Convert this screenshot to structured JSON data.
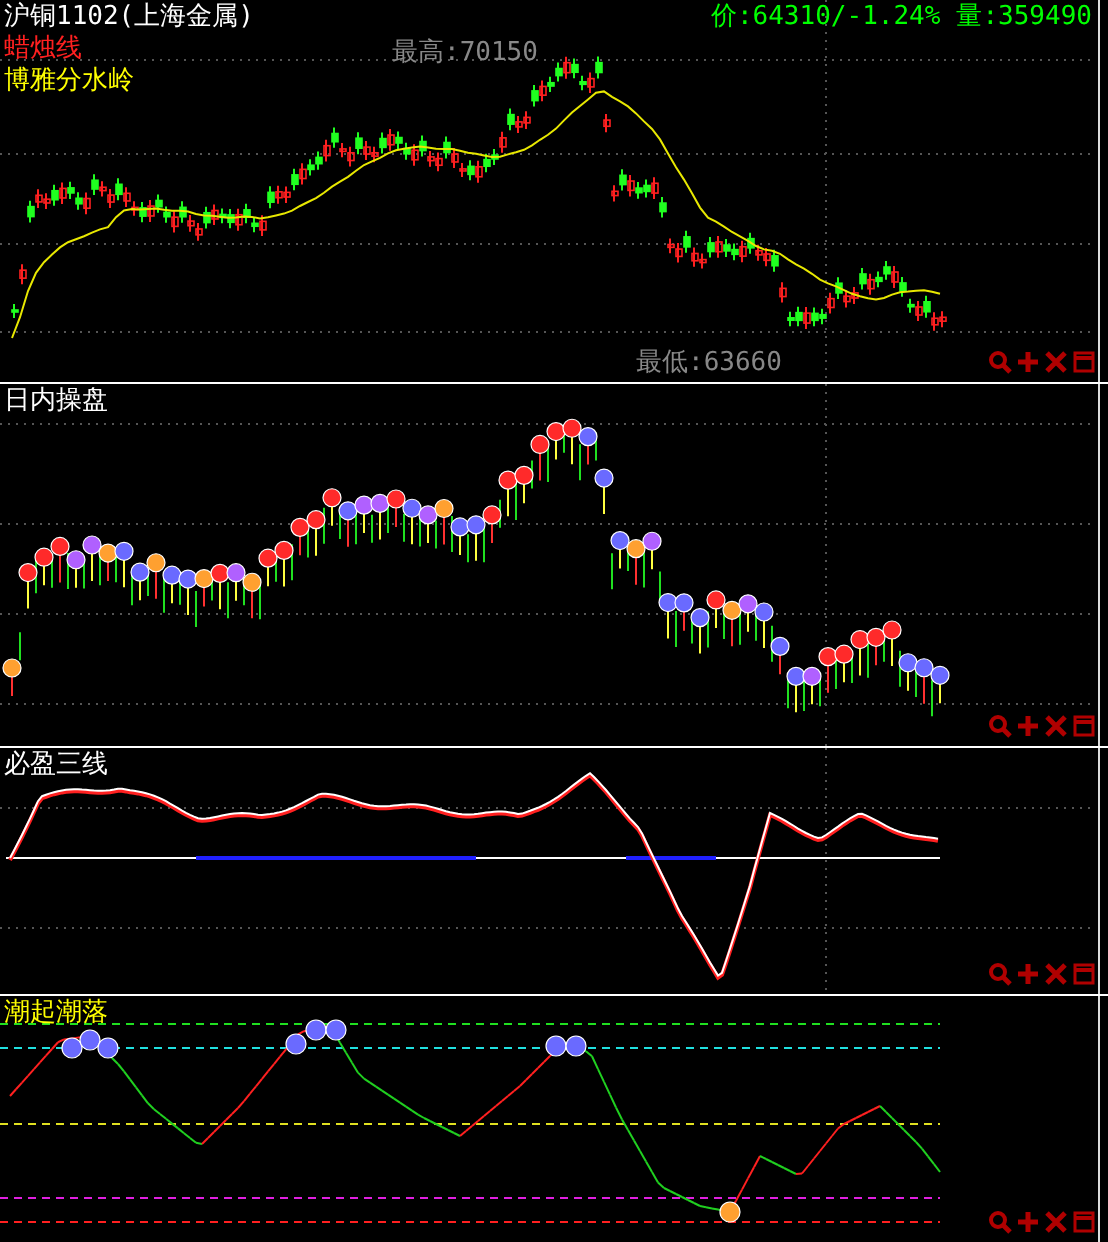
{
  "panels": [
    {
      "kind": "candles",
      "title": "沪铜1102(上海金属)",
      "legend": [
        {
          "label": "蜡烛线",
          "color": "#ff2020"
        },
        {
          "label": "博雅分水岭",
          "color": "#ffff00"
        }
      ],
      "quote": {
        "price": "价:64310/-1.24%",
        "volume": "量:359490"
      },
      "high_label": "最高:70150",
      "low_label": "最低:63660"
    },
    {
      "kind": "bubbles",
      "title": "日内操盘"
    },
    {
      "kind": "lines",
      "title": "必盈三线"
    },
    {
      "kind": "tide",
      "title": "潮起潮落"
    }
  ]
}
